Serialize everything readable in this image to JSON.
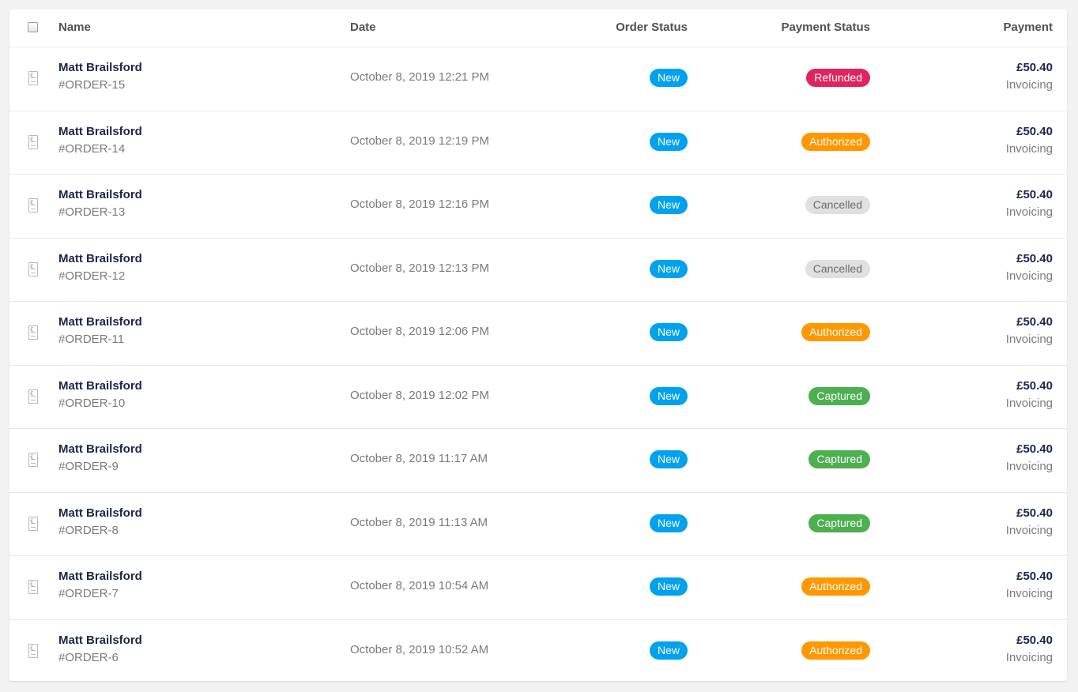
{
  "header": {
    "name": "Name",
    "date": "Date",
    "order_status": "Order Status",
    "payment_status": "Payment Status",
    "payment": "Payment"
  },
  "colors": {
    "new": "#00a2ef",
    "refunded": "#e0245e",
    "authorized": "#ff9800",
    "cancelled": "#e0e0e0",
    "captured": "#4caf50"
  },
  "icon": "receipt-icon",
  "rows": [
    {
      "customer": "Matt Brailsford",
      "order": "#ORDER-15",
      "date": "October 8, 2019 12:21 PM",
      "order_status": "New",
      "payment_status": "Refunded",
      "amount": "£50.40",
      "method": "Invoicing"
    },
    {
      "customer": "Matt Brailsford",
      "order": "#ORDER-14",
      "date": "October 8, 2019 12:19 PM",
      "order_status": "New",
      "payment_status": "Authorized",
      "amount": "£50.40",
      "method": "Invoicing"
    },
    {
      "customer": "Matt Brailsford",
      "order": "#ORDER-13",
      "date": "October 8, 2019 12:16 PM",
      "order_status": "New",
      "payment_status": "Cancelled",
      "amount": "£50.40",
      "method": "Invoicing"
    },
    {
      "customer": "Matt Brailsford",
      "order": "#ORDER-12",
      "date": "October 8, 2019 12:13 PM",
      "order_status": "New",
      "payment_status": "Cancelled",
      "amount": "£50.40",
      "method": "Invoicing"
    },
    {
      "customer": "Matt Brailsford",
      "order": "#ORDER-11",
      "date": "October 8, 2019 12:06 PM",
      "order_status": "New",
      "payment_status": "Authorized",
      "amount": "£50.40",
      "method": "Invoicing"
    },
    {
      "customer": "Matt Brailsford",
      "order": "#ORDER-10",
      "date": "October 8, 2019 12:02 PM",
      "order_status": "New",
      "payment_status": "Captured",
      "amount": "£50.40",
      "method": "Invoicing"
    },
    {
      "customer": "Matt Brailsford",
      "order": "#ORDER-9",
      "date": "October 8, 2019 11:17 AM",
      "order_status": "New",
      "payment_status": "Captured",
      "amount": "£50.40",
      "method": "Invoicing"
    },
    {
      "customer": "Matt Brailsford",
      "order": "#ORDER-8",
      "date": "October 8, 2019 11:13 AM",
      "order_status": "New",
      "payment_status": "Captured",
      "amount": "£50.40",
      "method": "Invoicing"
    },
    {
      "customer": "Matt Brailsford",
      "order": "#ORDER-7",
      "date": "October 8, 2019 10:54 AM",
      "order_status": "New",
      "payment_status": "Authorized",
      "amount": "£50.40",
      "method": "Invoicing"
    },
    {
      "customer": "Matt Brailsford",
      "order": "#ORDER-6",
      "date": "October 8, 2019 10:52 AM",
      "order_status": "New",
      "payment_status": "Authorized",
      "amount": "£50.40",
      "method": "Invoicing"
    }
  ]
}
